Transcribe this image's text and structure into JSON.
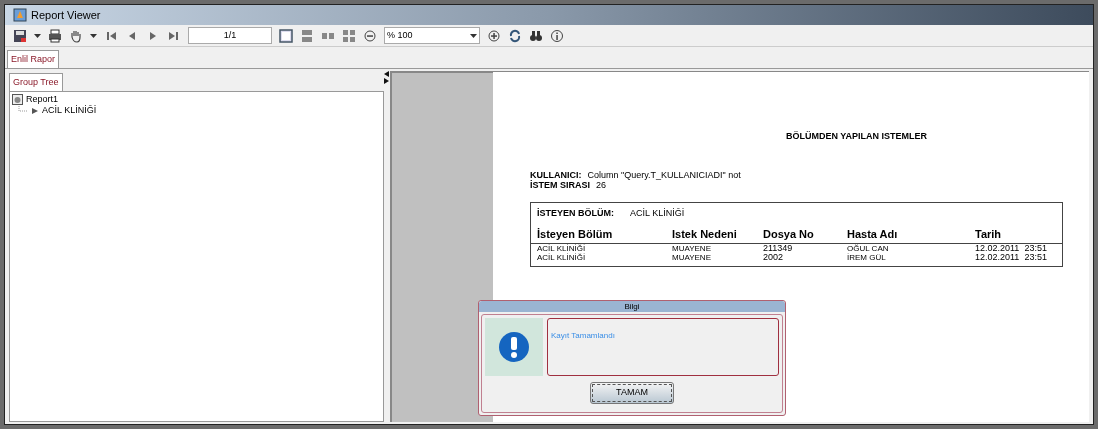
{
  "window": {
    "title": "Report Viewer"
  },
  "toolbar": {
    "page": "1/1",
    "zoom": "% 100"
  },
  "tabs": [
    {
      "label": "Enlil Rapor",
      "selected": true
    }
  ],
  "group_tree": {
    "tab": "Group Tree",
    "items": [
      {
        "label": "Report1",
        "children": [
          {
            "label": "ACİL KLİNİĞİ"
          }
        ]
      }
    ]
  },
  "report": {
    "title": "BÖLÜMDEN YAPILAN ISTEMLER",
    "fields": [
      {
        "label": "KULLANICI:",
        "value": "Column \"Query.T_KULLANICIADI\" not"
      },
      {
        "label": "İSTEM SIRASI",
        "value": "26"
      }
    ],
    "group": {
      "label": "İSTEYEN BÖLÜM:",
      "value": "ACİL KLİNİĞİ"
    },
    "columns": [
      "İsteyen Bölüm",
      "Istek Nedeni",
      "Dosya No",
      "Hasta Adı",
      "Tarih"
    ],
    "rows": [
      [
        "ACİL KLİNİĞİ",
        "MUAYENE",
        "211349",
        "OĞUL CAN",
        "12.02.2011  23:51"
      ],
      [
        "ACİL KLİNİĞİ",
        "MUAYENE",
        "2002",
        "İREM GÜL",
        "12.02.2011  23:51"
      ]
    ]
  },
  "dialog": {
    "title": "Bilgi",
    "message": "Kayıt Tamamlandı",
    "button": "TAMAM"
  }
}
